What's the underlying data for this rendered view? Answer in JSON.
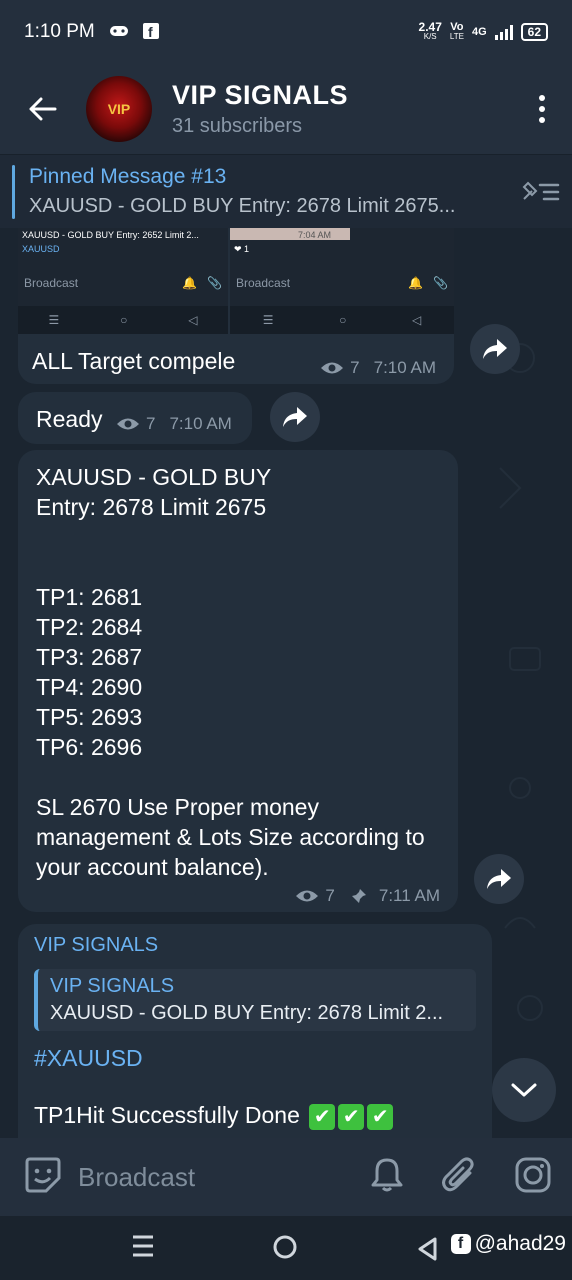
{
  "status_bar": {
    "time": "1:10 PM",
    "speed_value": "2.47",
    "speed_unit": "K/S",
    "volte_top": "Vo",
    "volte_bottom": "LTE",
    "network": "4G",
    "battery": "62"
  },
  "header": {
    "channel_name": "VIP SIGNALS",
    "subscribers": "31 subscribers",
    "avatar_text": "VIP"
  },
  "pinned": {
    "title": "Pinned Message #13",
    "body": "XAUUSD - GOLD BUY Entry: 2678 Limit 2675..."
  },
  "screenshots_preview": {
    "left_line1": "XAUUSD - GOLD BUY Entry: 2652 Limit 2...",
    "left_line2": "XAUUSD",
    "left_input": "Broadcast",
    "right_input": "Broadcast",
    "right_reaction": "1",
    "right_time": "7:04 AM"
  },
  "messages": [
    {
      "text": "ALL Target compele",
      "views": "7",
      "time": "7:10 AM"
    },
    {
      "text": "Ready",
      "views": "7",
      "time": "7:10 AM"
    },
    {
      "text": "XAUUSD - GOLD BUY\nEntry: 2678 Limit 2675\n\n\nTP1: 2681\nTP2: 2684\nTP3: 2687\nTP4: 2690\nTP5: 2693\nTP6: 2696\n\nSL 2670 Use Proper money management & Lots Size according to your account balance).",
      "views": "7",
      "time": "7:11 AM"
    },
    {
      "sender": "VIP SIGNALS",
      "reply_name": "VIP SIGNALS",
      "reply_text": "XAUUSD - GOLD BUY Entry: 2678 Limit 2...",
      "hashtag": "#XAUUSD",
      "text": "TP1Hit Successfully Done",
      "check_mark": "✔"
    }
  ],
  "input_bar": {
    "placeholder": "Broadcast"
  },
  "nav_bar": {
    "watermark": "@ahad29",
    "fb_letter": "f"
  }
}
